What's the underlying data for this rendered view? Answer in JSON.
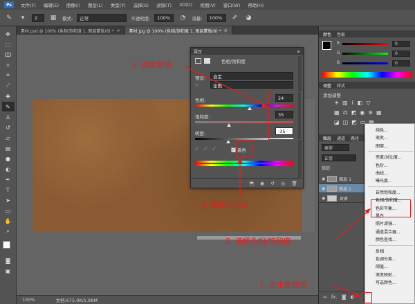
{
  "menubar": [
    "文件(F)",
    "编辑(E)",
    "图像(I)",
    "图层(L)",
    "类型(Y)",
    "选择(S)",
    "滤镜(T)",
    "3D(D)",
    "视图(V)",
    "窗口(W)",
    "帮助(H)"
  ],
  "optionsbar": {
    "brush_size": "2",
    "mode_label": "模式:",
    "mode_value": "正常",
    "opacity_label": "不透明度:",
    "opacity_value": "100%",
    "flow_label": "流量:",
    "flow_value": "100%"
  },
  "tabs": [
    {
      "label": "素材.psd @ 100% (色相/饱和度 1, 图层蒙版/8) *",
      "active": false
    },
    {
      "label": "素材.jpg @ 100% (色相/饱和度 1, 图层蒙版/8) *",
      "active": true
    }
  ],
  "status": {
    "zoom": "100%",
    "doc": "文档:675.0K/1.98M"
  },
  "properties": {
    "title": "属性",
    "subtitle": "色相/饱和度",
    "preset_label": "预设:",
    "preset_value": "自定",
    "channel_value": "全图",
    "hue_label": "色相:",
    "hue_value": "24",
    "sat_label": "饱和度:",
    "sat_value": "35",
    "light_label": "明度:",
    "light_value": "-35",
    "colorize_label": "着色"
  },
  "rightpanels": {
    "color_tabs": [
      "颜色",
      "色板"
    ],
    "rgb": [
      {
        "ch": "R",
        "v": "0"
      },
      {
        "ch": "G",
        "v": "0"
      },
      {
        "ch": "B",
        "v": "0"
      }
    ],
    "adjust_tabs": [
      "调整",
      "样式"
    ],
    "adjust_title": "添加调整",
    "layers_tabs": [
      "图层",
      "通道",
      "路径"
    ],
    "kind_value": "类型",
    "blend_value": "正常",
    "lock_label": "锁定:",
    "layers": [
      {
        "name": "图层 1",
        "selected": false
      },
      {
        "name": "图层 2",
        "selected": true
      },
      {
        "name": "背景",
        "selected": false
      }
    ],
    "fx_label": "fx."
  },
  "adjust_menu": {
    "items": [
      "纯色...",
      "渐变...",
      "图案...",
      "-",
      "亮度/对比度...",
      "色阶...",
      "曲线...",
      "曝光度...",
      "-",
      "自然饱和度...",
      "色相/饱和度...",
      "色彩平衡...",
      "黑白...",
      "照片滤镜...",
      "通道混合器...",
      "颜色查找...",
      "-",
      "反相",
      "色调分离...",
      "阈值...",
      "渐变映射...",
      "可选颜色..."
    ]
  },
  "annotations": {
    "step1": "1. 点击此按钮",
    "step2": "2. 选择色相/饱和度",
    "step3": "3. 将着色勾选",
    "step4": "1. 调整数值"
  },
  "colors": {
    "annotation": "#e02020",
    "canvas_texture": "#8a5b33",
    "selected_layer": "#6b8aa8"
  }
}
